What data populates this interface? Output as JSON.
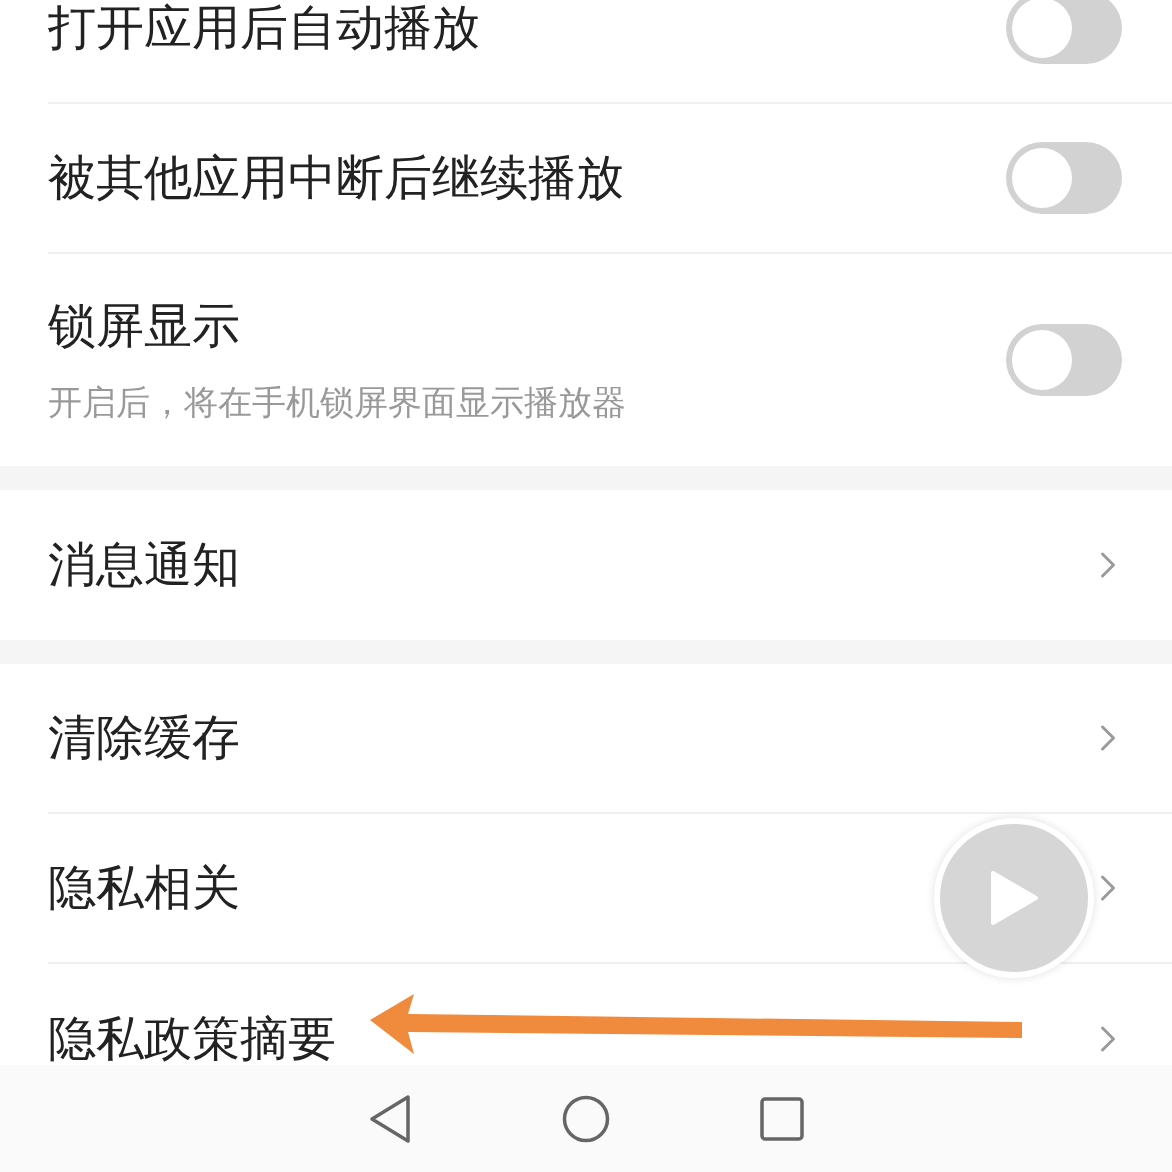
{
  "settings_groups": [
    {
      "rows": [
        {
          "kind": "toggle",
          "label": "打开应用后自动播放",
          "on": false
        },
        {
          "kind": "toggle",
          "label": "被其他应用中断后继续播放",
          "on": false
        },
        {
          "kind": "toggle",
          "label": "锁屏显示",
          "description": "开启后，将在手机锁屏界面显示播放器",
          "on": false
        }
      ]
    },
    {
      "rows": [
        {
          "kind": "link",
          "label": "消息通知"
        }
      ]
    },
    {
      "rows": [
        {
          "kind": "link",
          "label": "清除缓存"
        },
        {
          "kind": "link",
          "label": "隐私相关"
        },
        {
          "kind": "link",
          "label": "隐私政策摘要"
        }
      ]
    }
  ]
}
